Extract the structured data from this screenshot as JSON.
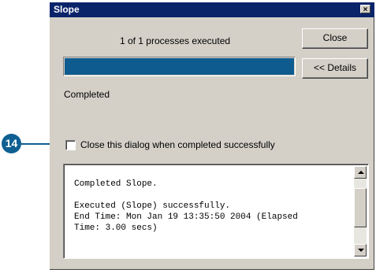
{
  "callout": {
    "number": "14",
    "color": "#0f5f92"
  },
  "dialog": {
    "title": "Slope",
    "close_glyph": "×",
    "status_text": "1 of 1 processes executed",
    "close_button_label": "Close",
    "details_button_label": "<< Details",
    "progress_fraction": 1.0,
    "progress_color": "#0e5b8f",
    "completed_text": "Completed",
    "checkbox_label": "Close this dialog when completed successfully",
    "checkbox_checked": false,
    "log_lines": [
      "Completed Slope.",
      "",
      "Executed (Slope) successfully.",
      "End Time: Mon Jan 19 13:35:50 2004 (Elapsed",
      "Time: 3.00 secs)"
    ]
  }
}
